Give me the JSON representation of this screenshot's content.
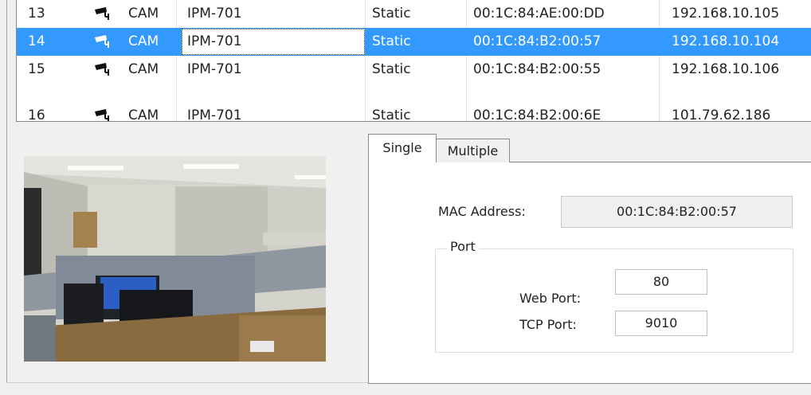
{
  "devices": [
    {
      "num": "13",
      "type": "CAM",
      "model": "IPM-701",
      "mode": "Static",
      "mac": "00:1C:84:AE:00:DD",
      "ip": "192.168.10.105",
      "selected": false
    },
    {
      "num": "14",
      "type": "CAM",
      "model": "IPM-701",
      "mode": "Static",
      "mac": "00:1C:84:B2:00:57",
      "ip": "192.168.10.104",
      "selected": true
    },
    {
      "num": "15",
      "type": "CAM",
      "model": "IPM-701",
      "mode": "Static",
      "mac": "00:1C:84:B2:00:55",
      "ip": "192.168.10.106",
      "selected": false
    },
    {
      "num": "16",
      "type": "CAM",
      "model": "IPM-701",
      "mode": "Static",
      "mac": "00:1C:84:B2:00:6E",
      "ip": "101.79.62.186",
      "selected": false
    }
  ],
  "icons": {
    "device_type": "cctv-camera-icon"
  },
  "colors": {
    "selection": "#3399ff",
    "selection_text": "#ffffff"
  },
  "tabs": [
    {
      "label": "Single",
      "active": true
    },
    {
      "label": "Multiple",
      "active": false
    }
  ],
  "single": {
    "mac_label": "MAC Address:",
    "mac_value": "00:1C:84:B2:00:57",
    "port_group_label": "Port",
    "web_port_label": "Web Port:",
    "web_port_value": "80",
    "tcp_port_label": "TCP Port:",
    "tcp_port_value": "9010"
  }
}
